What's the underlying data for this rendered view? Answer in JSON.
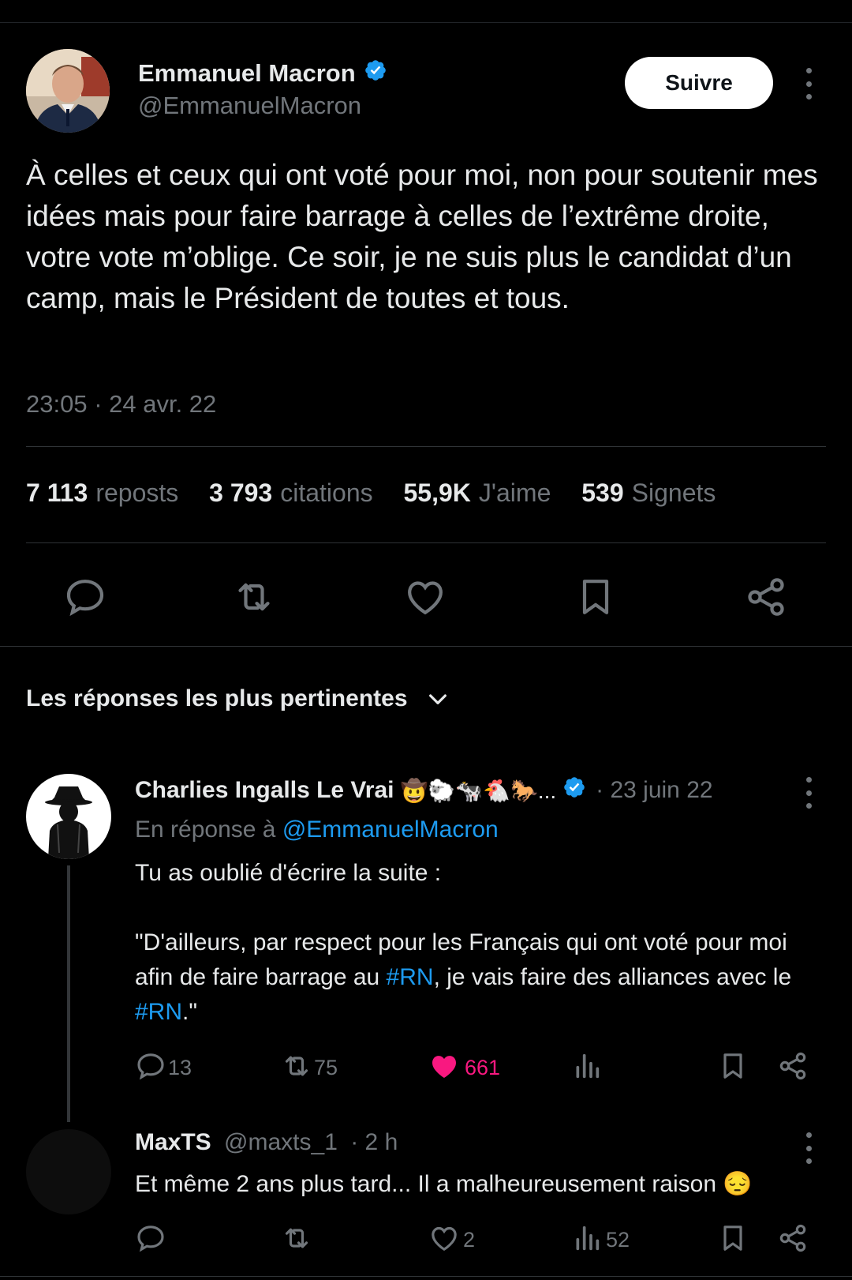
{
  "tweet": {
    "author_name": "Emmanuel Macron",
    "author_handle": "@EmmanuelMacron",
    "follow_label": "Suivre",
    "text": "À celles et ceux qui ont voté pour moi, non pour soutenir mes idées mais pour faire barrage à celles de l’extrême droite, votre vote m’oblige. Ce soir, je ne suis plus le candidat d’un camp, mais le Président de toutes et tous.",
    "timestamp": "23:05 · 24 avr. 22",
    "stats": [
      {
        "value": "7 113",
        "label": "reposts"
      },
      {
        "value": "3 793",
        "label": "citations"
      },
      {
        "value": "55,9K",
        "label": "J'aime"
      },
      {
        "value": "539",
        "label": "Signets"
      }
    ]
  },
  "replies_header": "Les réponses les plus pertinentes",
  "replies": [
    {
      "author_name": "Charlies Ingalls Le Vrai",
      "author_emojis": "🤠🐑🐄🐔🐎...",
      "date": "· 23 juin 22",
      "reply_to_prefix": "En réponse à",
      "reply_to_handle": "@EmmanuelMacron",
      "line1": "Tu as oublié d'écrire la suite :",
      "quote_a": "\"D'ailleurs, par respect pour les Français qui ont voté pour moi afin de faire barrage au ",
      "hashtag1": "#RN",
      "quote_b": ", je vais faire des alliances avec le ",
      "hashtag2": "#RN",
      "quote_c": ".\"",
      "replies_count": "13",
      "reposts_count": "75",
      "likes_count": "661"
    },
    {
      "author_name": "MaxTS",
      "author_handle": "@maxts_1",
      "date": "· 2 h",
      "text": "Et même 2 ans plus tard... Il a malheureusement raison 😔",
      "likes_count": "2",
      "views_count": "52"
    }
  ],
  "colors": {
    "background": "#000000",
    "text": "#e7e9ea",
    "muted": "#71767b",
    "accent": "#1d9bf0",
    "like": "#f91880"
  }
}
